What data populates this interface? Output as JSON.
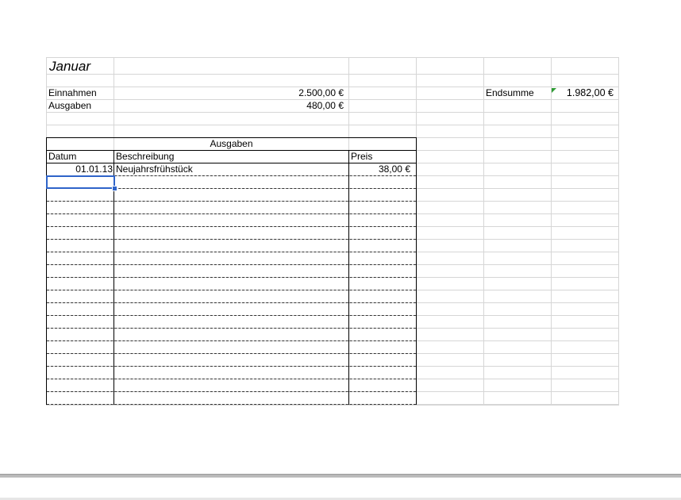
{
  "sheet": {
    "title": "Januar",
    "income_label": "Einnahmen",
    "income_value": "2.500,00 €",
    "expenses_label": "Ausgaben",
    "expenses_value": "480,00 €",
    "total_label": "Endsumme",
    "total_value": "1.982,00 €"
  },
  "expenses_table": {
    "title": "Ausgaben",
    "headers": {
      "date": "Datum",
      "description": "Beschreibung",
      "price": "Preis"
    },
    "rows": [
      {
        "date": "01.01.13",
        "description": "Neujahrsfrühstück",
        "price": "38,00 €"
      }
    ]
  }
}
